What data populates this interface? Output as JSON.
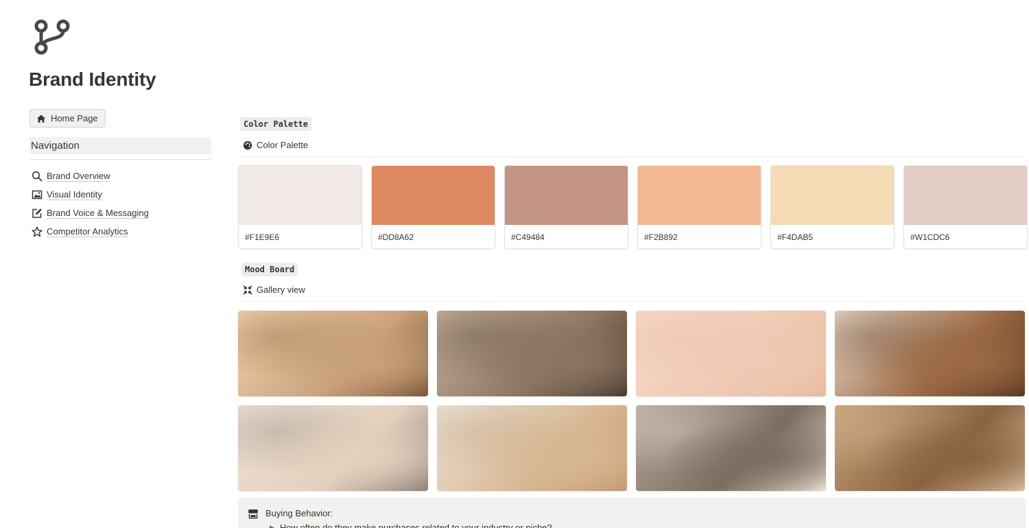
{
  "page": {
    "title": "Brand Identity",
    "icon": "branch-icon"
  },
  "sidebar": {
    "home_button": "Home Page",
    "nav_heading": "Navigation",
    "items": [
      {
        "label": "Brand Overview",
        "icon": "search-icon"
      },
      {
        "label": "Visual Identity",
        "icon": "image-icon"
      },
      {
        "label": "Brand Voice & Messaging",
        "icon": "edit-icon"
      },
      {
        "label": "Competitor Analytics",
        "icon": "star-icon"
      }
    ]
  },
  "color_palette": {
    "section_label": "Color Palette",
    "view_tab": "Color Palette",
    "swatches": [
      {
        "code": "#F1E9E6",
        "color": "#F1E9E6"
      },
      {
        "code": "#DD8A62",
        "color": "#DD8A62"
      },
      {
        "code": "#C49484",
        "color": "#C49484"
      },
      {
        "code": "#F2B892",
        "color": "#F2B892"
      },
      {
        "code": "#F4DAB5",
        "color": "#F4DAB5"
      },
      {
        "code": "#W1CDC6",
        "color": "#E1CDC6"
      }
    ]
  },
  "mood_board": {
    "section_label": "Mood Board",
    "view_tab": "Gallery view",
    "images": [
      {
        "name": "shadow-flowers-image",
        "colors": [
          "#f5d6b0",
          "#c9a27c",
          "#7a5331"
        ]
      },
      {
        "name": "palm-leaves-image",
        "colors": [
          "#c9b3a0",
          "#8c7562",
          "#4a3b2f"
        ]
      },
      {
        "name": "cream-texture-image",
        "colors": [
          "#f6d9c8",
          "#efc9b3",
          "#e9b9a0"
        ]
      },
      {
        "name": "pampas-fabric-image",
        "colors": [
          "#e9dccb",
          "#9c6a45",
          "#5a3621"
        ]
      },
      {
        "name": "rose-shells-image",
        "colors": [
          "#efe1d3",
          "#e4d0be",
          "#8a7f76"
        ]
      },
      {
        "name": "foundation-swatch-image",
        "colors": [
          "#ebe5dc",
          "#d8b894",
          "#c39a72"
        ]
      },
      {
        "name": "book-pearls-image",
        "colors": [
          "#b8ab9e",
          "#7c6d60",
          "#e9e1d3"
        ]
      },
      {
        "name": "perfume-silk-image",
        "colors": [
          "#c9a47c",
          "#8a6442",
          "#d9bf9e"
        ]
      }
    ]
  },
  "callout": {
    "icon": "store-icon",
    "title": "Buying Behavior:",
    "question": "How often do they make purchases related to your industry or niche?"
  }
}
